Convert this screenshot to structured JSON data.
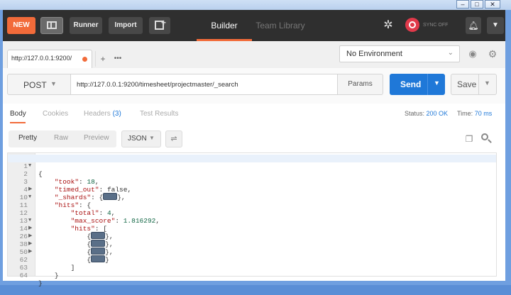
{
  "header": {
    "new_label": "NEW",
    "runner_label": "Runner",
    "import_label": "Import",
    "tabs": [
      "Builder",
      "Team Library"
    ],
    "sync_label": "SYNC OFF"
  },
  "window": {
    "minimize": "–",
    "maximize": "□",
    "close": "✕"
  },
  "request_tab": {
    "title": "http://127.0.0.1:9200/",
    "plus": "+",
    "more": "•••"
  },
  "environment": {
    "selected": "No Environment"
  },
  "request": {
    "method": "POST",
    "url": "http://127.0.0.1:9200/timesheet/projectmaster/_search",
    "params_label": "Params",
    "send_label": "Send",
    "save_label": "Save"
  },
  "response": {
    "tabs": {
      "body": "Body",
      "cookies": "Cookies",
      "headers": "Headers",
      "headers_count": "(3)",
      "test_results": "Test Results"
    },
    "status_label": "Status:",
    "status_value": "200 OK",
    "time_label": "Time:",
    "time_value": "70 ms",
    "view_modes": [
      "Pretty",
      "Raw",
      "Preview"
    ],
    "format": "JSON"
  },
  "editor": {
    "lines": [
      {
        "num": "1",
        "fold": "▼"
      },
      {
        "num": "2"
      },
      {
        "num": "3"
      },
      {
        "num": "4",
        "fold": "▶"
      },
      {
        "num": "10",
        "fold": "▼"
      },
      {
        "num": "11"
      },
      {
        "num": "12"
      },
      {
        "num": "13",
        "fold": "▼"
      },
      {
        "num": "14",
        "fold": "▶"
      },
      {
        "num": "26",
        "fold": "▶"
      },
      {
        "num": "38",
        "fold": "▶"
      },
      {
        "num": "50",
        "fold": "▶"
      },
      {
        "num": "62"
      },
      {
        "num": "63"
      },
      {
        "num": "64"
      }
    ],
    "tokens": {
      "open_brace": "{",
      "took_key": "\"took\"",
      "took_val": "18",
      "timed_out_key": "\"timed_out\"",
      "timed_out_val": "false",
      "shards_key": "\"_shards\"",
      "hits_key": "\"hits\"",
      "total_key": "\"total\"",
      "total_val": "4",
      "max_score_key": "\"max_score\"",
      "max_score_val": "1.816292",
      "inner_hits_key": "\"hits\"",
      "close_bracket": "]",
      "close_brace": "}"
    }
  }
}
